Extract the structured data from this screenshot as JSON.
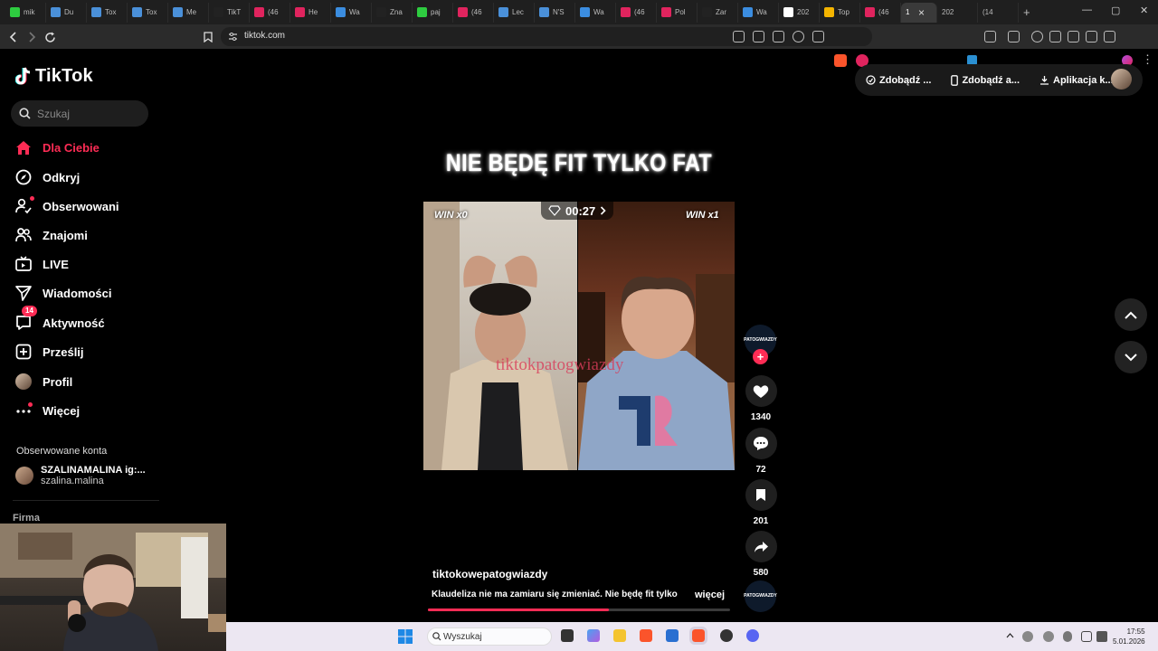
{
  "browser": {
    "tabs": [
      {
        "label": "mik",
        "color": "#2ecc40"
      },
      {
        "label": "Du",
        "color": "#4a90d9"
      },
      {
        "label": "Tox",
        "color": "#4a90d9"
      },
      {
        "label": "Tox",
        "color": "#4a90d9"
      },
      {
        "label": "Me",
        "color": "#4a90d9"
      },
      {
        "label": "TikT",
        "color": "#222222"
      },
      {
        "label": "(46",
        "color": "#e0245e"
      },
      {
        "label": "He",
        "color": "#e0245e"
      },
      {
        "label": "Wa",
        "color": "#3b8de0"
      },
      {
        "label": "Zna",
        "color": "#222222"
      },
      {
        "label": "paj",
        "color": "#2ecc40"
      },
      {
        "label": "(46",
        "color": "#e0245e"
      },
      {
        "label": "Lec",
        "color": "#4a90d9"
      },
      {
        "label": "N'S",
        "color": "#4a90d9"
      },
      {
        "label": "Wa",
        "color": "#3b8de0"
      },
      {
        "label": "(46",
        "color": "#e0245e"
      },
      {
        "label": "Pol",
        "color": "#e0245e"
      },
      {
        "label": "Zar",
        "color": "#222222"
      },
      {
        "label": "Wa",
        "color": "#3b8de0"
      },
      {
        "label": "202",
        "color": "#ffffff"
      },
      {
        "label": "Top",
        "color": "#f4b400"
      },
      {
        "label": "(46",
        "color": "#e0245e"
      }
    ],
    "active_tab_label": "1",
    "extra_tabs": [
      {
        "label": "202"
      },
      {
        "label": "(14"
      }
    ],
    "new_tab_label": "+",
    "url": "tiktok.com"
  },
  "tiktok": {
    "logo_text": "TikTok",
    "search_placeholder": "Szukaj",
    "nav": [
      {
        "label": "Dla Ciebie",
        "icon": "home-icon"
      },
      {
        "label": "Odkryj",
        "icon": "compass-icon"
      },
      {
        "label": "Obserwowani",
        "icon": "following-icon"
      },
      {
        "label": "Znajomi",
        "icon": "friends-icon"
      },
      {
        "label": "LIVE",
        "icon": "live-icon"
      },
      {
        "label": "Wiadomości",
        "icon": "messages-icon"
      },
      {
        "label": "Aktywność",
        "icon": "activity-icon",
        "badge": "14"
      },
      {
        "label": "Prześlij",
        "icon": "upload-icon"
      },
      {
        "label": "Profil",
        "icon": "profile-avatar"
      },
      {
        "label": "Więcej",
        "icon": "more-icon"
      }
    ],
    "followed_title": "Obserwowane konta",
    "followed_account": {
      "name": "SZALINAMALINA ig:...",
      "handle": "szalina.malina"
    },
    "footer_section": "Firma",
    "top_actions": [
      "Zdobądź ...",
      "Zdobądź a...",
      "Aplikacja k..."
    ],
    "video": {
      "overlay_title": "NIE BĘDĘ FIT TYLKO FAT",
      "win_left": "WIN x0",
      "win_right": "WIN x1",
      "timer": "00:27",
      "watermark": "tiktokpatogwiazdy",
      "author": "tiktokowepatogwiazdy",
      "description": "Klaudeliza nie ma zamiaru się zmieniać. Nie będę fit tylko",
      "more_label": "więcej",
      "progress": 0.6
    },
    "actions": {
      "likes": "1340",
      "comments": "72",
      "saves": "201",
      "shares": "580"
    },
    "profile_badge_text": "PATOGWIAZDY"
  },
  "taskbar": {
    "search_placeholder": "Wyszukaj",
    "time": "17:55",
    "date": "5.01.2026"
  },
  "colors": {
    "accent": "#fe2c55",
    "background": "#000000"
  }
}
